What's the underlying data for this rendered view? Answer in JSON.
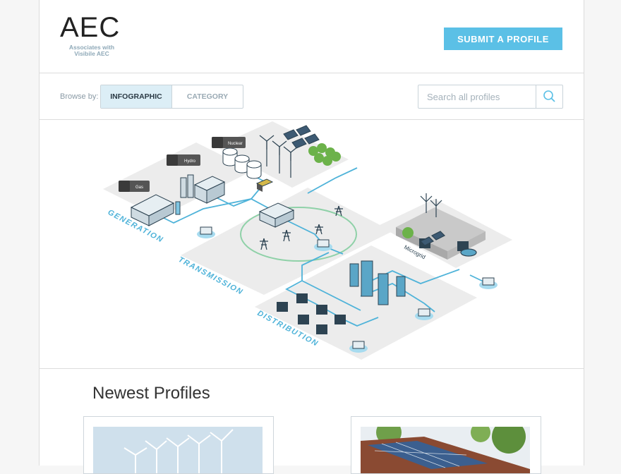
{
  "header": {
    "logo": "AEC",
    "tagline": "Associates with Visibile AEC",
    "submit_label": "SUBMIT A PROFILE"
  },
  "browse": {
    "label": "Browse by:",
    "tabs": [
      {
        "label": "INFOGRAPHIC",
        "active": true
      },
      {
        "label": "CATEGORY",
        "active": false
      }
    ]
  },
  "search": {
    "placeholder": "Search all profiles",
    "value": ""
  },
  "infographic": {
    "sections": [
      "GENERATION",
      "TRANSMISSION",
      "DISTRIBUTION"
    ],
    "tags": [
      "Gas",
      "Hydro",
      "Nuclear"
    ],
    "microgrid_label": "Microgrid"
  },
  "newest": {
    "title": "Newest Profiles",
    "cards": [
      {
        "image": "wind-turbines-photo"
      },
      {
        "image": "solar-roof-photo"
      }
    ]
  },
  "colors": {
    "accent": "#5bc0e6",
    "line": "#4fb3d9",
    "platform": "#e9e9e9"
  }
}
